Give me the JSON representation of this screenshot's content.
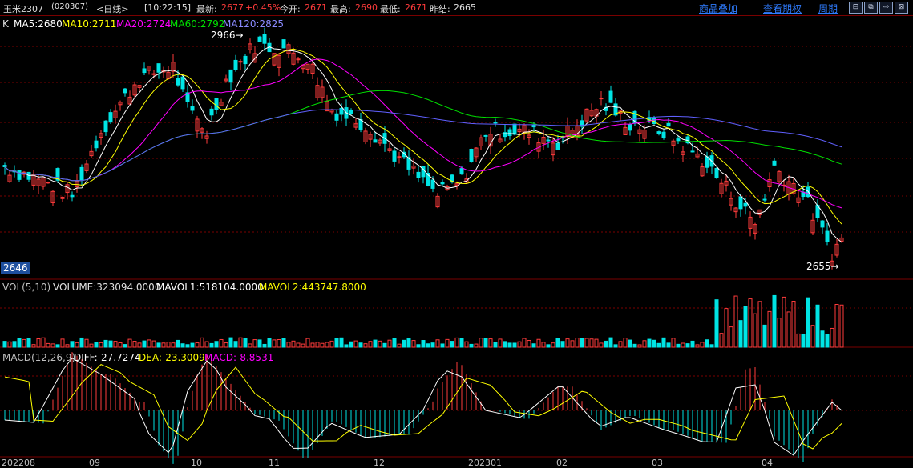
{
  "topbar": {
    "symbol": "玉米2307",
    "code": "(020307)",
    "period": "<日线>",
    "time": "[10:22:15]",
    "latest_label": "最新:",
    "latest_value": "2677",
    "change": "+0.45%",
    "open_label": "今开:",
    "open_value": "2671",
    "high_label": "最高:",
    "high_value": "2690",
    "low_label": "最低:",
    "low_value": "2671",
    "prev_label": "昨结:",
    "prev_value": "2665",
    "links": [
      "商品叠加",
      "查看期权",
      "周期"
    ],
    "icons": [
      "window-restore-icon",
      "window-split-icon",
      "arrow-right-icon",
      "window-close-icon"
    ]
  },
  "indicators": {
    "k_label": "K",
    "ma5": "MA5:2680",
    "ma10": "MA10:2711",
    "ma20": "MA20:2724",
    "ma60": "MA60:2792",
    "ma120": "MA120:2825",
    "high_mark": "2966",
    "low_mark": "2655",
    "price_cursor": "2646",
    "vol_title": "VOL(5,10)",
    "volume": "VOLUME:323094.0000",
    "mavol1": "MAVOL1:518104.0000",
    "mavol2": "MAVOL2:443747.8000",
    "macd_title": "MACD(12,26,9)",
    "diff": "DIFF:-27.7274",
    "dea": "DEA:-23.3009",
    "macd": "MACD:-8.8531"
  },
  "x_axis": [
    "202208",
    "09",
    "10",
    "11",
    "12",
    "202301",
    "02",
    "03",
    "04"
  ],
  "colors": {
    "up": "#ff3b3b",
    "down": "#00e5e5",
    "ma5": "#ffffff",
    "ma10": "#ffff00",
    "ma20": "#ff00ff",
    "ma60": "#00e000",
    "ma120": "#6060ff",
    "grid": "#7a0000",
    "link": "#2f7cff",
    "cursor": "#1e4f9e"
  }
}
